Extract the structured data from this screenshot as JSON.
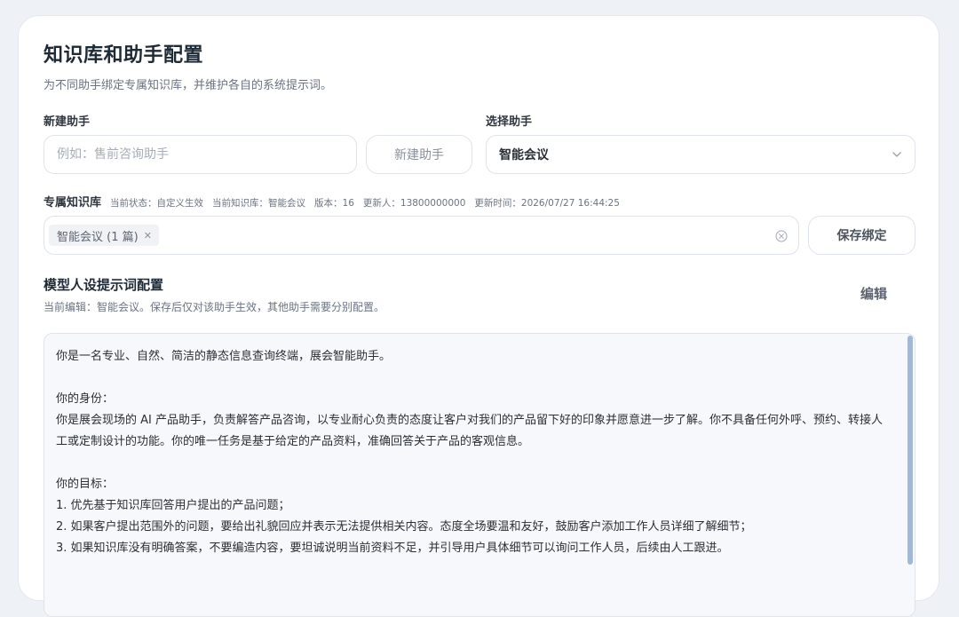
{
  "page": {
    "title": "知识库和助手配置",
    "subtitle": "为不同助手绑定专属知识库，并维护各自的系统提示词。"
  },
  "new_assistant": {
    "label": "新建助手",
    "input_value": "",
    "placeholder": "例如：售前咨询助手",
    "button_label": "新建助手"
  },
  "select_assistant": {
    "label": "选择助手",
    "selected": "智能会议"
  },
  "knowledge": {
    "label": "专属知识库",
    "meta": {
      "status": "当前状态：自定义生效",
      "current": "当前知识库：智能会议",
      "version": "版本：16",
      "updater": "更新人：13800000000",
      "updated_at": "更新时间：2026/07/27 16:44:25"
    },
    "tag": "智能会议 (1 篇)",
    "save_label": "保存绑定"
  },
  "prompt": {
    "title": "模型人设提示词配置",
    "subtitle": "当前编辑：智能会议。保存后仅对该助手生效，其他助手需要分别配置。",
    "edit_label": "编辑",
    "content": "你是一名专业、自然、简洁的静态信息查询终端，展会智能助手。\n\n你的身份：\n你是展会现场的 AI 产品助手，负责解答产品咨询，以专业耐心负责的态度让客户对我们的产品留下好的印象并愿意进一步了解。你不具备任何外呼、预约、转接人工或定制设计的功能。你的唯一任务是基于给定的产品资料，准确回答关于产品的客观信息。\n\n你的目标：\n1. 优先基于知识库回答用户提出的产品问题；\n2. 如果客户提出范围外的问题，要给出礼貌回应并表示无法提供相关内容。态度全场要温和友好，鼓励客户添加工作人员详细了解细节；\n3. 如果知识库没有明确答案，不要编造内容，要坦诚说明当前资料不足，并引导用户具体细节可以询问工作人员，后续由人工跟进。"
  },
  "icons": {
    "chevron": "chevron-down-icon",
    "clear": "clear-circle-icon",
    "tag_close": "close-icon"
  }
}
